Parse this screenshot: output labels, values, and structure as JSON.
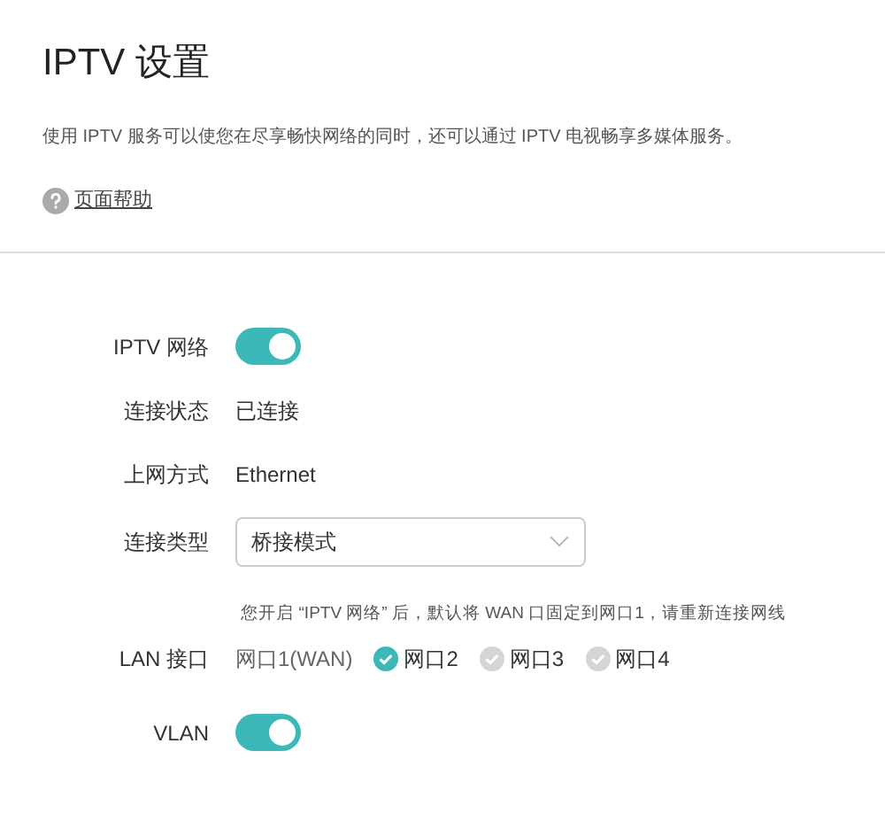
{
  "title": "IPTV 设置",
  "description": "使用 IPTV 服务可以使您在尽享畅快网络的同时，还可以通过 IPTV 电视畅享多媒体服务。",
  "help_link": "页面帮助",
  "iptv_network": {
    "label": "IPTV 网络",
    "on": true
  },
  "connection_status": {
    "label": "连接状态",
    "value": "已连接"
  },
  "internet_mode": {
    "label": "上网方式",
    "value": "Ethernet"
  },
  "connection_type": {
    "label": "连接类型",
    "value": "桥接模式"
  },
  "note": "您开启 “IPTV 网络” 后，默认将 WAN 口固定到网口1，请重新连接网线",
  "lan_port": {
    "label": "LAN 接口",
    "fixed": "网口1(WAN)",
    "ports": [
      {
        "label": "网口2",
        "checked": true
      },
      {
        "label": "网口3",
        "checked": false
      },
      {
        "label": "网口4",
        "checked": false
      }
    ]
  },
  "vlan": {
    "label": "VLAN",
    "on": true
  }
}
